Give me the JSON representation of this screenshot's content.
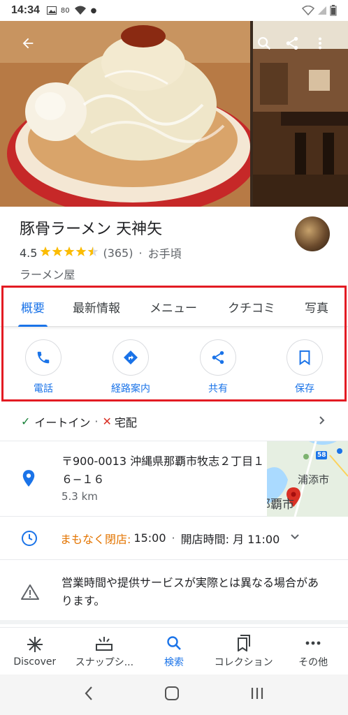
{
  "status_bar": {
    "time": "14:34",
    "battery_pct": "80"
  },
  "header_actions": [
    "back-icon",
    "search-icon",
    "share-icon",
    "more-vert-icon"
  ],
  "place": {
    "title": "豚骨ラーメン 天神矢",
    "rating": "4.5",
    "stars_filled": 4.5,
    "review_count": "(365)",
    "price": "お手頃",
    "category": "ラーメン屋"
  },
  "tabs": [
    {
      "label": "概要",
      "active": true
    },
    {
      "label": "最新情報",
      "active": false
    },
    {
      "label": "メニュー",
      "active": false
    },
    {
      "label": "クチコミ",
      "active": false
    },
    {
      "label": "写真",
      "active": false
    }
  ],
  "actions": [
    {
      "label": "電話",
      "icon": "phone-icon"
    },
    {
      "label": "経路案内",
      "icon": "directions-icon"
    },
    {
      "label": "共有",
      "icon": "share-icon"
    },
    {
      "label": "保存",
      "icon": "bookmark-icon"
    }
  ],
  "dining": {
    "dine_in": "イートイン",
    "delivery": "宅配",
    "separator": "·"
  },
  "address": {
    "line": "〒900-0013 沖縄県那覇市牧志２丁目１６−１６",
    "distance": "5.3 km",
    "map_labels": {
      "city1": "浦添市",
      "city2": "那覇市",
      "route": "58"
    }
  },
  "hours": {
    "status": "まもなく閉店:",
    "close_time": "15:00",
    "separator": "·",
    "open_info": "開店時間: 月 11:00"
  },
  "notice": {
    "text": "営業時間や提供サービスが実際とは異なる場合があります。"
  },
  "bottom_nav": [
    {
      "label": "Discover",
      "icon": "discover-icon",
      "active": false
    },
    {
      "label": "スナップシ...",
      "icon": "snapshot-icon",
      "active": false
    },
    {
      "label": "検索",
      "icon": "search-icon",
      "active": true
    },
    {
      "label": "コレクション",
      "icon": "collection-icon",
      "active": false
    },
    {
      "label": "その他",
      "icon": "more-horiz-icon",
      "active": false
    }
  ],
  "colors": {
    "accent": "#1a73e8",
    "highlight": "#e31b23",
    "star": "#fbbc04",
    "closing": "#e37400"
  }
}
